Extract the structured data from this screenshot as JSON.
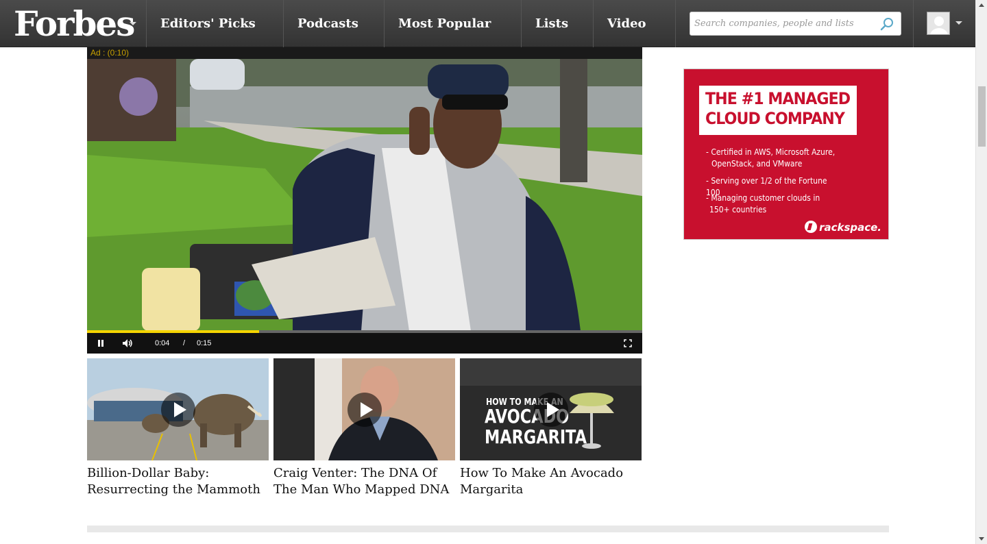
{
  "header": {
    "logo": "Forbes",
    "nav": [
      "Editors' Picks",
      "Podcasts",
      "Most Popular",
      "Lists",
      "Video"
    ],
    "search_placeholder": "Search companies, people and lists"
  },
  "player": {
    "ad_label": "Ad : (0:10)",
    "current_time": "0:04",
    "separator": "/",
    "duration": "0:15",
    "progress_fraction": 0.31
  },
  "videos": [
    {
      "title": "Billion-Dollar Baby: Resurrecting the Mammoth",
      "overlay": ""
    },
    {
      "title": "Craig Venter: The DNA Of The Man Who Mapped DNA",
      "overlay": ""
    },
    {
      "title": "How To Make An Avocado Margarita",
      "overlay_line1": "HOW TO MAKE AN",
      "overlay_line2": "AVOCADO",
      "overlay_line3": "MARGARITA"
    }
  ],
  "ad": {
    "headline_line1": "THE #1 MANAGED",
    "headline_line2": "CLOUD COMPANY",
    "bullets": [
      "- Certified in AWS, Microsoft Azure,",
      "  OpenStack, and VMware",
      "- Serving over 1/2 of the Fortune 100",
      "- Managing customer clouds in",
      "  150+ countries"
    ],
    "brand": "rackspace."
  },
  "colors": {
    "nav_bg": "#3d3d3d",
    "ad_red": "#c8102e",
    "progress": "#f5d400"
  }
}
